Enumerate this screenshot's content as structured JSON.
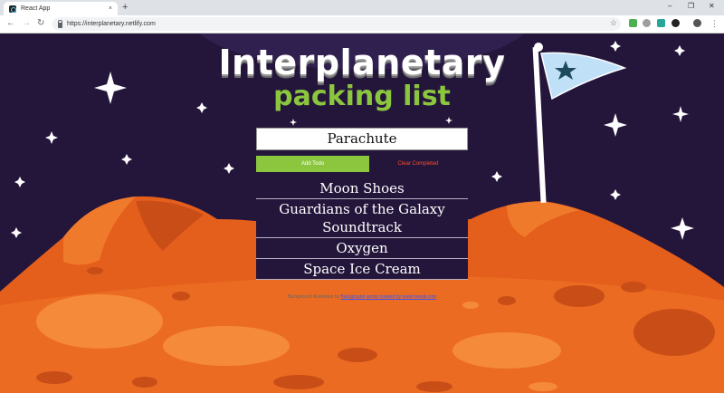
{
  "browser": {
    "tab_title": "React App",
    "tab_close": "×",
    "new_tab": "+",
    "url": "https://interplanetary.netlify.com",
    "window_controls": [
      "–",
      "❐",
      "✕"
    ],
    "nav_icons": [
      "back-icon",
      "forward-icon",
      "reload-icon"
    ]
  },
  "page": {
    "title": "Interplanetary",
    "subtitle": "packing list",
    "input_value": "Parachute",
    "add_button": "Add Todo",
    "clear_button": "Clear Completed",
    "todos": [
      "Moon Shoes",
      "Guardians of the Galaxy Soundtrack",
      "Oxygen",
      "Space Ice Cream"
    ],
    "credit_prefix": "Background illustration by ",
    "credit_link": "Background vector created by www.freepik.com"
  },
  "colors": {
    "sky": "#24163b",
    "ground": "#e45e1c",
    "accent_green": "#8cc63f",
    "clear_red": "#ff4b2b",
    "flag": "#bfe0f7"
  }
}
